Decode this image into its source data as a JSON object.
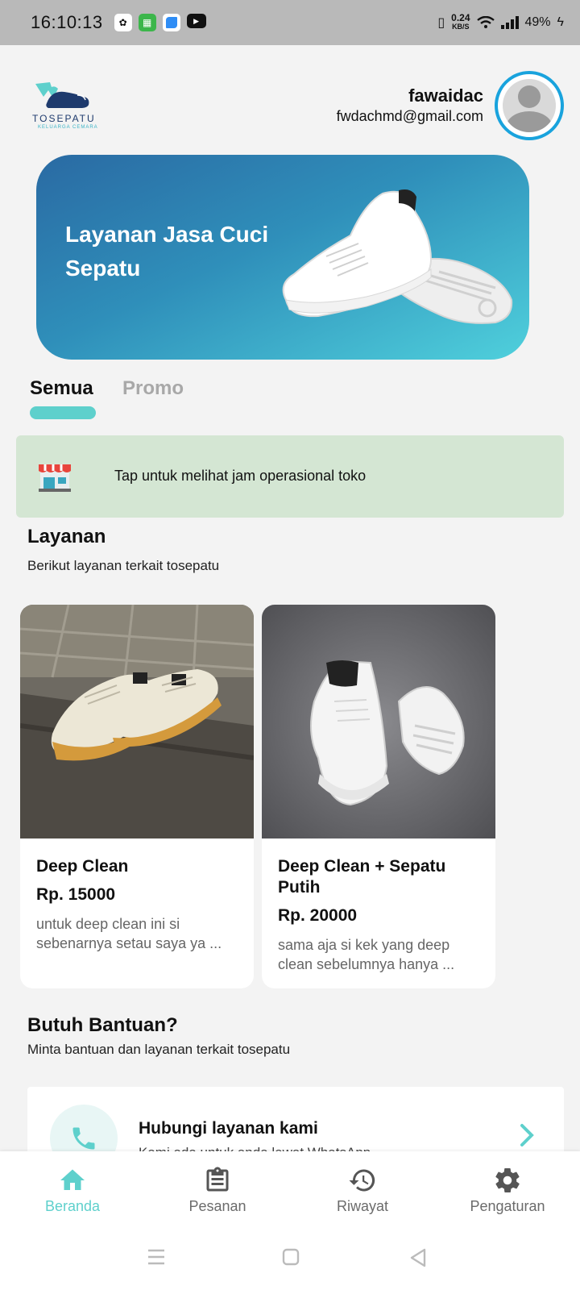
{
  "status_bar": {
    "time": "16:10:13",
    "net_speed": "0.24",
    "net_unit": "KB/S",
    "battery": "49%"
  },
  "header": {
    "logo_text": "TOSEPATU",
    "logo_sub": "KELUARGA CEMARA",
    "user_name": "fawaidac",
    "user_email": "fwdachmd@gmail.com"
  },
  "banner": {
    "title": "Layanan Jasa Cuci Sepatu"
  },
  "tabs": [
    {
      "label": "Semua",
      "active": true
    },
    {
      "label": "Promo",
      "active": false
    }
  ],
  "store_info": {
    "text": "Tap untuk melihat jam operasional toko"
  },
  "services": {
    "title": "Layanan",
    "subtitle": "Berikut layanan terkait tosepatu",
    "items": [
      {
        "name": "Deep Clean",
        "price": "Rp. 15000",
        "desc": "untuk deep clean ini si sebenarnya setau saya ya ..."
      },
      {
        "name": "Deep Clean + Sepatu Putih",
        "price": "Rp. 20000",
        "desc": "sama aja si kek yang deep clean sebelumnya hanya ..."
      }
    ]
  },
  "help": {
    "title": "Butuh Bantuan?",
    "subtitle": "Minta bantuan dan layanan terkait tosepatu",
    "card_title": "Hubungi layanan kami",
    "card_sub": "Kami ada untuk anda lewat WhatsApp"
  },
  "bottom_nav": [
    {
      "label": "Beranda",
      "icon": "home-icon",
      "active": true
    },
    {
      "label": "Pesanan",
      "icon": "clipboard-icon",
      "active": false
    },
    {
      "label": "Riwayat",
      "icon": "history-icon",
      "active": false
    },
    {
      "label": "Pengaturan",
      "icon": "gear-icon",
      "active": false
    }
  ],
  "colors": {
    "accent": "#5ed0cc",
    "banner_start": "#2a6aa3",
    "banner_end": "#4fd0dc",
    "info_bg": "#d4e6d3",
    "avatar_ring": "#19a3dd"
  }
}
